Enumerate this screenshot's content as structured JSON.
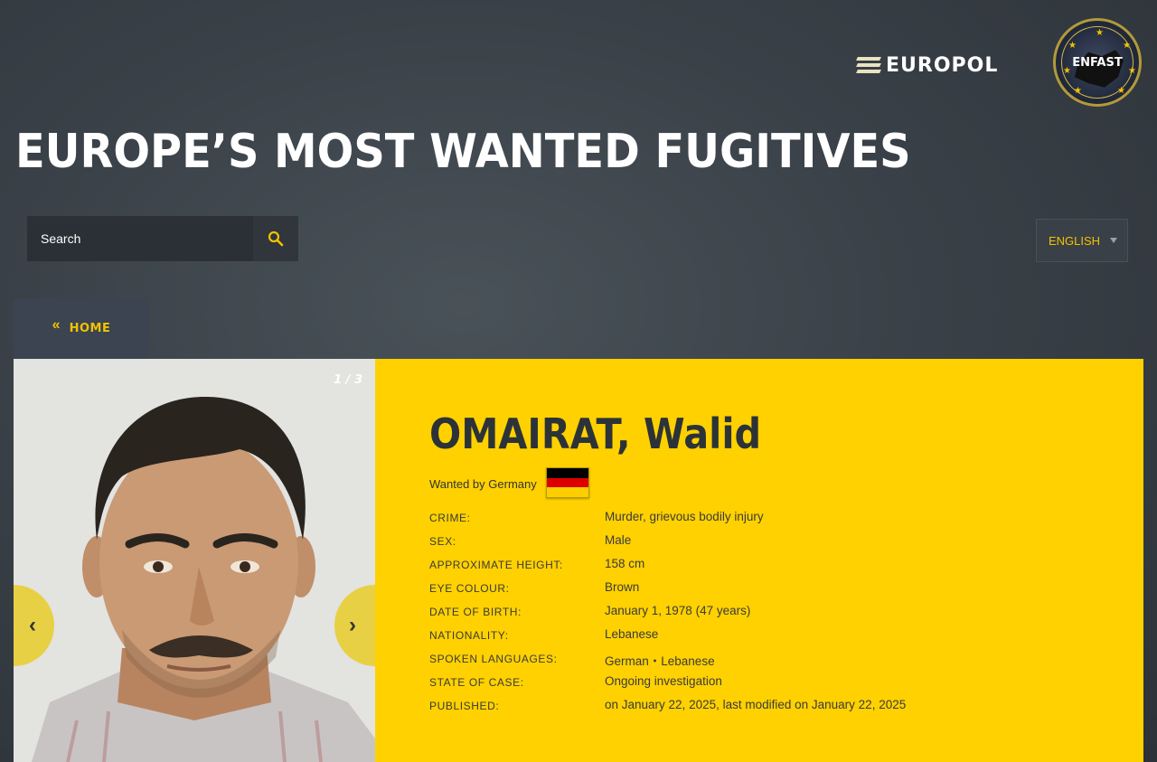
{
  "brand": {
    "europol_label": "EUROPOL",
    "enfast_label": "ENFAST"
  },
  "header": {
    "title": "EUROPE’S MOST WANTED FUGITIVES"
  },
  "search": {
    "placeholder": "Search"
  },
  "language": {
    "selected": "ENGLISH"
  },
  "nav": {
    "home_label": "HOME"
  },
  "gallery": {
    "counter": "1 / 3"
  },
  "fugitive": {
    "name": "OMAIRAT, Walid",
    "wanted_by": "Wanted by Germany",
    "flag_colors": [
      "#000000",
      "#dd0000",
      "#ffce00"
    ],
    "fields": [
      {
        "label": "CRIME:",
        "value": "Murder, grievous bodily injury"
      },
      {
        "label": "SEX:",
        "value": "Male"
      },
      {
        "label": "APPROXIMATE HEIGHT:",
        "value": "158 cm"
      },
      {
        "label": "EYE COLOUR:",
        "value": "Brown"
      },
      {
        "label": "DATE OF BIRTH:",
        "value": "January 1, 1978 (47 years)"
      },
      {
        "label": "NATIONALITY:",
        "value": "Lebanese"
      },
      {
        "label": "SPOKEN LANGUAGES:",
        "value": "German・Lebanese"
      },
      {
        "label": "STATE OF CASE:",
        "value": "Ongoing investigation"
      },
      {
        "label": "PUBLISHED:",
        "value": "on January 22, 2025, last modified on January 22, 2025"
      }
    ]
  },
  "colors": {
    "accent": "#ffd100",
    "link_yellow": "#f2c200",
    "dark": "#2c3338"
  }
}
